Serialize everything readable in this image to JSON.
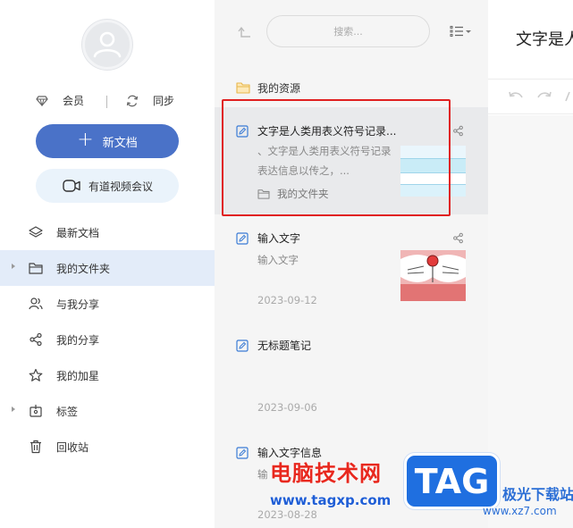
{
  "sidebar": {
    "member_label": "会员",
    "sync_label": "同步",
    "new_doc_label": "新文档",
    "meeting_label": "有道视频会议",
    "items": [
      {
        "label": "最新文档"
      },
      {
        "label": "我的文件夹"
      },
      {
        "label": "与我分享"
      },
      {
        "label": "我的分享"
      },
      {
        "label": "我的加星"
      },
      {
        "label": "标签"
      },
      {
        "label": "回收站"
      }
    ]
  },
  "list": {
    "search_placeholder": "搜索...",
    "folder": "我的资源",
    "notes": [
      {
        "title": "文字是人类用表义符号记录...",
        "snippet": "、文字是人类用表义符号记录表达信息以传之，...",
        "path": "我的文件夹"
      },
      {
        "title": "输入文字",
        "snippet": "输入文字",
        "date": "2023-09-12"
      },
      {
        "title": "无标题笔记",
        "date": "2023-09-06"
      },
      {
        "title": "输入文字信息",
        "snippet": "输",
        "date": "2023-08-28"
      }
    ]
  },
  "editor": {
    "title": "文字是人"
  },
  "watermark": {
    "site_name": "电脑技术网",
    "site_url": "www.tagxp.com",
    "tag": "TAG",
    "xz_name": "极光下载站",
    "xz_url": "www.xz7.com"
  },
  "colors": {
    "accent": "#4a72c8",
    "selection": "#e3ecf9",
    "highlight": "#e02020"
  }
}
